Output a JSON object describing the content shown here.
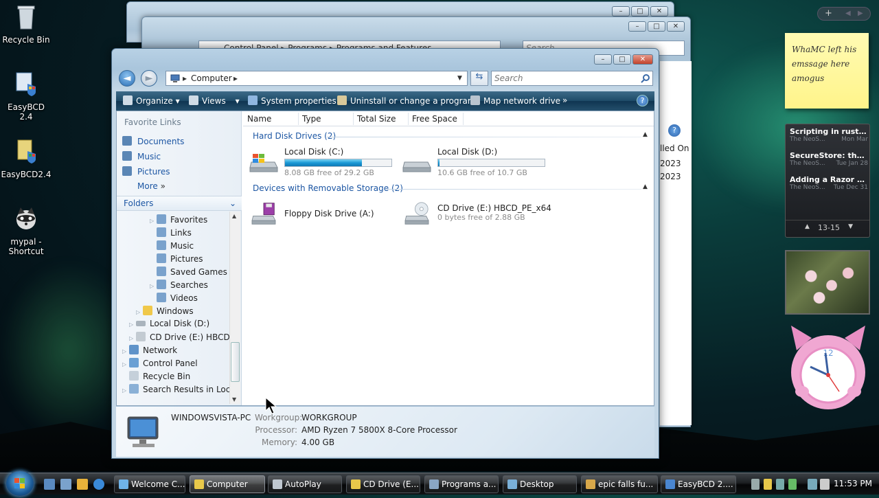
{
  "desktop": {
    "icons": [
      {
        "label": "Recycle Bin"
      },
      {
        "label": "EasyBCD 2.4"
      },
      {
        "label": "EasyBCD2.4"
      },
      {
        "label": "mypal - Shortcut"
      }
    ]
  },
  "bg_window": {
    "breadcrumb": [
      "Control Panel",
      "Programs",
      "Programs and Features"
    ],
    "search_placeholder": "Search",
    "col_header": "lled On",
    "dates": [
      "2023",
      "2023"
    ]
  },
  "window": {
    "breadcrumb": "Computer",
    "search_placeholder": "Search",
    "toolbar": {
      "organize": "Organize",
      "views": "Views",
      "system_properties": "System properties",
      "uninstall": "Uninstall or change a program",
      "map_drive": "Map network drive",
      "more": "»"
    },
    "nav": {
      "favorite_links_title": "Favorite Links",
      "favorites": [
        "Documents",
        "Music",
        "Pictures"
      ],
      "more": "More",
      "folders": "Folders",
      "tree": [
        "Favorites",
        "Links",
        "Music",
        "Pictures",
        "Saved Games",
        "Searches",
        "Videos",
        "Windows",
        "Local Disk (D:)",
        "CD Drive (E:) HBCD_P",
        "Network",
        "Control Panel",
        "Recycle Bin",
        "Search Results in Local"
      ]
    },
    "columns": [
      "Name",
      "Type",
      "Total Size",
      "Free Space"
    ],
    "groups": {
      "hdd": "Hard Disk Drives (2)",
      "removable": "Devices with Removable Storage (2)"
    },
    "drives": {
      "c": {
        "name": "Local Disk (C:)",
        "free": "8.08 GB free of 29.2 GB",
        "used_fraction": 0.72
      },
      "d": {
        "name": "Local Disk (D:)",
        "free": "10.6 GB free of 10.7 GB",
        "used_fraction": 0.01
      },
      "a": {
        "name": "Floppy Disk Drive (A:)"
      },
      "e": {
        "name": "CD Drive (E:) HBCD_PE_x64",
        "free": "0 bytes free of 2.88 GB"
      }
    },
    "details": {
      "computer_name": "WINDOWSVISTA-PC",
      "workgroup_label": "Workgroup:",
      "workgroup": "WORKGROUP",
      "processor_label": "Processor:",
      "processor": "AMD Ryzen 7 5800X 8-Core Processor",
      "memory_label": "Memory:",
      "memory": "4.00 GB"
    }
  },
  "gadgets": {
    "note": "WhaMC left his emssage here amogus",
    "feed": [
      {
        "title": "Scripting in rust with...",
        "source": "The NeoS...",
        "date": "Mon Mar"
      },
      {
        "title": "SecureStore: the ope...",
        "source": "The NeoS...",
        "date": "Tue Jan 28"
      },
      {
        "title": "Adding a Razor Page...",
        "source": "The NeoS...",
        "date": "Tue Dec 31"
      }
    ],
    "pager": "13-15",
    "top_plus": "+"
  },
  "taskbar": {
    "buttons": [
      "Welcome C...",
      "Computer",
      "AutoPlay",
      "CD Drive (E...",
      "Programs a...",
      "Desktop",
      "epic falls fu...",
      "EasyBCD 2...."
    ],
    "time": "11:53 PM"
  },
  "colors": {
    "accent": "#1c56a3",
    "toolbar": "#1e4b68",
    "progress": "#1a99d6"
  }
}
